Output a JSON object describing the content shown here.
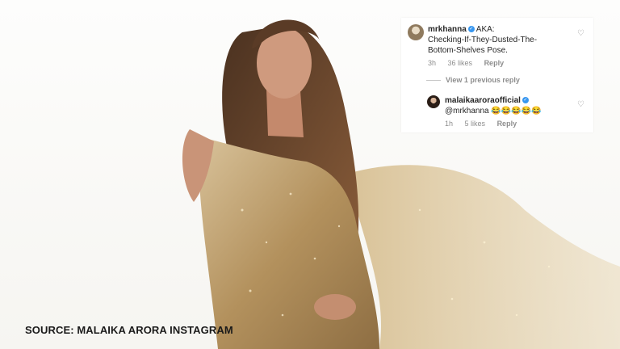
{
  "comment_thread": {
    "comment": {
      "username": "mrkhanna",
      "text_line1": "AKA:",
      "text_line2": "Checking-If-They-Dusted-The-",
      "text_line3": "Bottom-Shelves Pose.",
      "time": "3h",
      "likes": "36 likes",
      "reply": "Reply"
    },
    "view_previous": "View 1 previous reply",
    "reply": {
      "username": "malaikaaroraofficial",
      "text": "@mrkhanna 😂😂😂😂😂",
      "time": "1h",
      "likes": "5 likes",
      "reply": "Reply"
    }
  },
  "caption": {
    "source": "SOURCE: MALAIKA ARORA INSTAGRAM"
  },
  "colors": {
    "dress_gold": "#b89a6a",
    "hair_brown": "#6b4a30",
    "skin": "#c99478",
    "verified_blue": "#3897f0"
  }
}
